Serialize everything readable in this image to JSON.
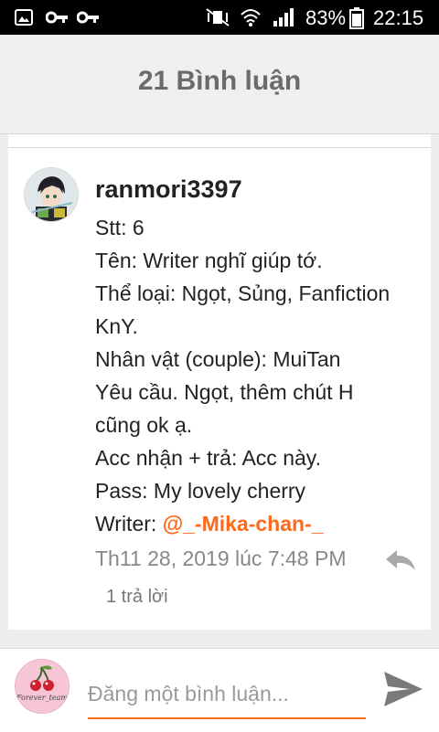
{
  "status_bar": {
    "battery_percent": "83%",
    "time": "22:15",
    "icons": [
      "image-icon",
      "key-icon",
      "key-icon",
      "mute-icon",
      "wifi-icon",
      "signal-icon",
      "battery-icon"
    ]
  },
  "header": {
    "title": "21 Bình luận"
  },
  "comment": {
    "username": "ranmori3397",
    "lines": [
      "Stt: 6",
      "Tên: Writer nghĩ giúp tớ.",
      "Thể loại: Ngọt, Sủng, Fanfiction",
      "KnY.",
      "Nhân vật (couple): MuiTan",
      "Yêu cầu. Ngọt, thêm chút H",
      "cũng ok ạ.",
      "Acc nhận + trả: Acc này.",
      "Pass: My lovely cherry"
    ],
    "writer_label": "Writer: ",
    "writer_mention": "@_-Mika-chan-_",
    "timestamp": "Th11 28, 2019 lúc 7:48 PM",
    "replies_count": "1 trả lời"
  },
  "composer": {
    "placeholder": "Đăng một bình luận...",
    "avatar_caption": "Forever_team",
    "accent_color": "#ff6a1a"
  }
}
